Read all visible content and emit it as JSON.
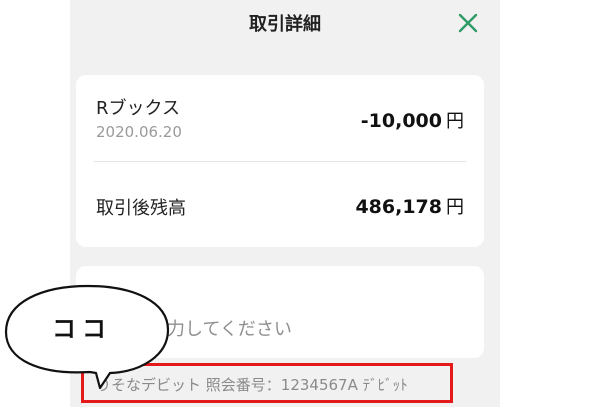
{
  "header": {
    "title": "取引詳細"
  },
  "icons": {
    "close": "close-icon"
  },
  "colors": {
    "accent": "#2e9b66",
    "highlight": "#e41a1a",
    "panel": "#f1f1f1"
  },
  "transaction": {
    "merchant": "Rブックス",
    "date": "2020.06.20",
    "amount": "-10,000",
    "unit": "円"
  },
  "balance": {
    "label": "取引後残高",
    "amount": "486,178",
    "unit": "円"
  },
  "memo": {
    "placeholder_visible": "力してください"
  },
  "detail": {
    "text": "りそなデビット 照会番号：1234567A ﾃﾞﾋﾞｯﾄ"
  },
  "callout": {
    "text": "ココ"
  }
}
